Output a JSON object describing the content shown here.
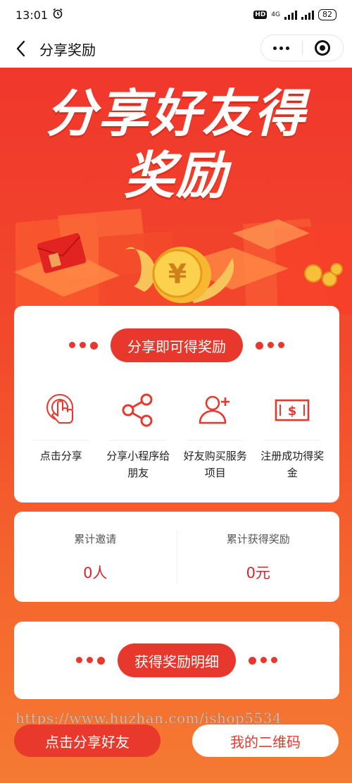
{
  "status_bar": {
    "time": "13:01",
    "hd": "HD",
    "network": "4G",
    "battery": "82"
  },
  "nav": {
    "title": "分享奖励"
  },
  "hero": {
    "line1": "分享好友得",
    "line2": "奖励"
  },
  "how_card": {
    "pill": "分享即可得奖励",
    "steps": [
      {
        "icon": "tap-hand-icon",
        "label": "点击分享"
      },
      {
        "icon": "share-icon",
        "label": "分享小程序给朋友"
      },
      {
        "icon": "add-user-icon",
        "label": "好友购买服务项目"
      },
      {
        "icon": "cash-icon",
        "label": "注册成功得奖金"
      }
    ]
  },
  "stats": {
    "invites_label": "累计邀请",
    "invites_value": "0人",
    "rewards_label": "累计获得奖励",
    "rewards_value": "0元"
  },
  "details_card": {
    "pill": "获得奖励明细"
  },
  "watermark": "https://www.huzhan.com/ishop5534",
  "buttons": {
    "share": "点击分享好友",
    "qr": "我的二维码"
  },
  "colors": {
    "accent": "#e8372c",
    "value_red": "#d4282a",
    "bg_top": "#f0372c",
    "bg_bottom": "#f57a32"
  }
}
